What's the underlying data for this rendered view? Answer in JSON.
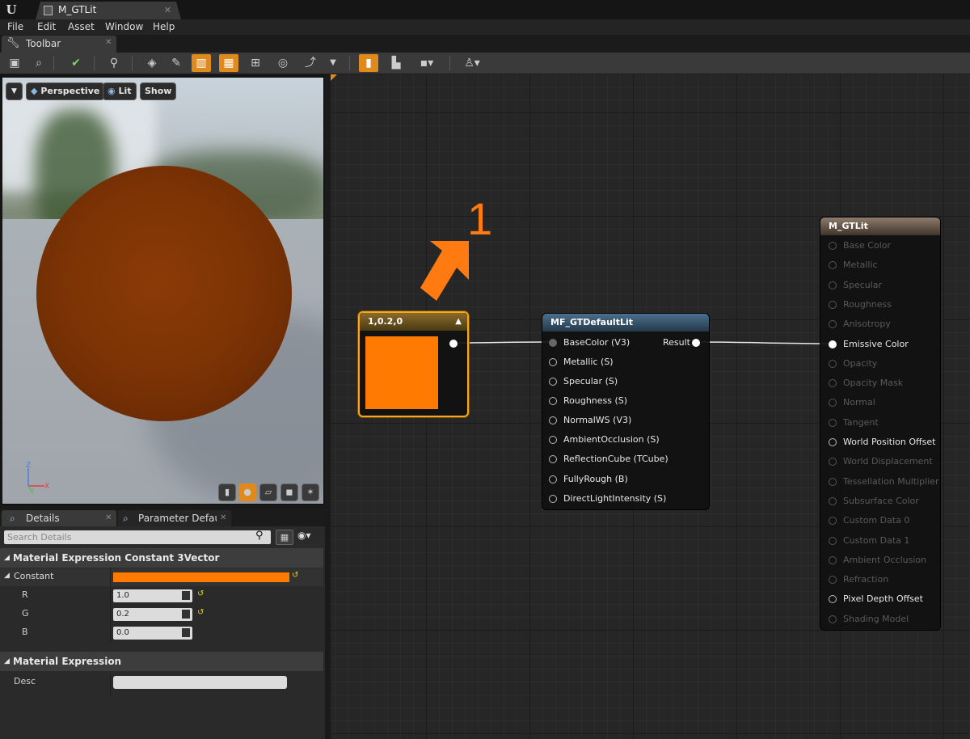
{
  "window": {
    "tab_title": "M_GTLit",
    "menu": [
      "File",
      "Edit",
      "Asset",
      "Window",
      "Help"
    ],
    "toolbar_tab": "Toolbar"
  },
  "viewport": {
    "buttons": {
      "perspective": "Perspective",
      "lit": "Lit",
      "show": "Show"
    },
    "axis": {
      "z": "Z",
      "y": "Y",
      "x": "X"
    },
    "preview_color": "#7e3405"
  },
  "details": {
    "tabs": [
      "Details",
      "Parameter Defaults"
    ],
    "search_placeholder": "Search Details",
    "category1": "Material Expression Constant 3Vector",
    "constant_label": "Constant",
    "constant_color": "#ff7a00",
    "props": [
      {
        "label": "R",
        "value": "1.0"
      },
      {
        "label": "G",
        "value": "0.2"
      },
      {
        "label": "B",
        "value": "0.0"
      }
    ],
    "category2": "Material Expression",
    "desc_label": "Desc"
  },
  "annotation": {
    "number": "1",
    "color": "#ff7a10"
  },
  "nodes": {
    "constant": {
      "title": "1,0.2,0",
      "swatch_color": "#ff7a00"
    },
    "function": {
      "title": "MF_GTDefaultLit",
      "output": "Result",
      "inputs": [
        "BaseColor (V3)",
        "Metallic (S)",
        "Specular (S)",
        "Roughness (S)",
        "NormalWS (V3)",
        "AmbientOcclusion (S)",
        "ReflectionCube (TCube)",
        "FullyRough (B)",
        "DirectLightIntensity (S)"
      ]
    },
    "result": {
      "title": "M_GTLit",
      "inputs": [
        {
          "label": "Base Color",
          "active": false
        },
        {
          "label": "Metallic",
          "active": false
        },
        {
          "label": "Specular",
          "active": false
        },
        {
          "label": "Roughness",
          "active": false
        },
        {
          "label": "Anisotropy",
          "active": false
        },
        {
          "label": "Emissive Color",
          "active": true,
          "connected": true
        },
        {
          "label": "Opacity",
          "active": false
        },
        {
          "label": "Opacity Mask",
          "active": false
        },
        {
          "label": "Normal",
          "active": false
        },
        {
          "label": "Tangent",
          "active": false
        },
        {
          "label": "World Position Offset",
          "active": true
        },
        {
          "label": "World Displacement",
          "active": false
        },
        {
          "label": "Tessellation Multiplier",
          "active": false
        },
        {
          "label": "Subsurface Color",
          "active": false
        },
        {
          "label": "Custom Data 0",
          "active": false
        },
        {
          "label": "Custom Data 1",
          "active": false
        },
        {
          "label": "Ambient Occlusion",
          "active": false
        },
        {
          "label": "Refraction",
          "active": false
        },
        {
          "label": "Pixel Depth Offset",
          "active": true
        },
        {
          "label": "Shading Model",
          "active": false
        }
      ]
    }
  }
}
